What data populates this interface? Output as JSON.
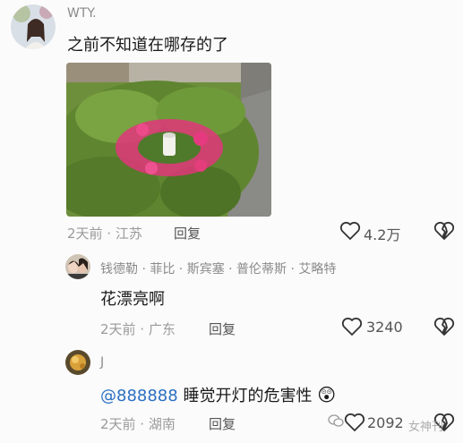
{
  "comments": [
    {
      "username": "WTY.",
      "text": "之前不知道在哪存的了",
      "time_location": "2天前 · 江苏",
      "reply_label": "回复",
      "like_count": "4.2万",
      "avatar_icon": "avatar-woman-photo",
      "has_image": true
    },
    {
      "username": "钱德勒 · 菲比 · 斯宾塞 · 普伦蒂斯 · 艾略特",
      "text": "花漂亮啊",
      "time_location": "2天前 · 广东",
      "reply_label": "回复",
      "like_count": "3240",
      "avatar_icon": "avatar-couple-photo"
    },
    {
      "username": "J",
      "mention": "@888888",
      "text": " 睡觉开灯的危害性",
      "emoji": "😲",
      "time_location": "2天前 · 湖南",
      "reply_label": "回复",
      "like_count": "2092",
      "avatar_icon": "avatar-golden-photo"
    }
  ],
  "watermark": "女神刊",
  "colors": {
    "background": "#fbfbfb",
    "mention": "#2b6fc2",
    "meta": "#9a9a9a"
  }
}
